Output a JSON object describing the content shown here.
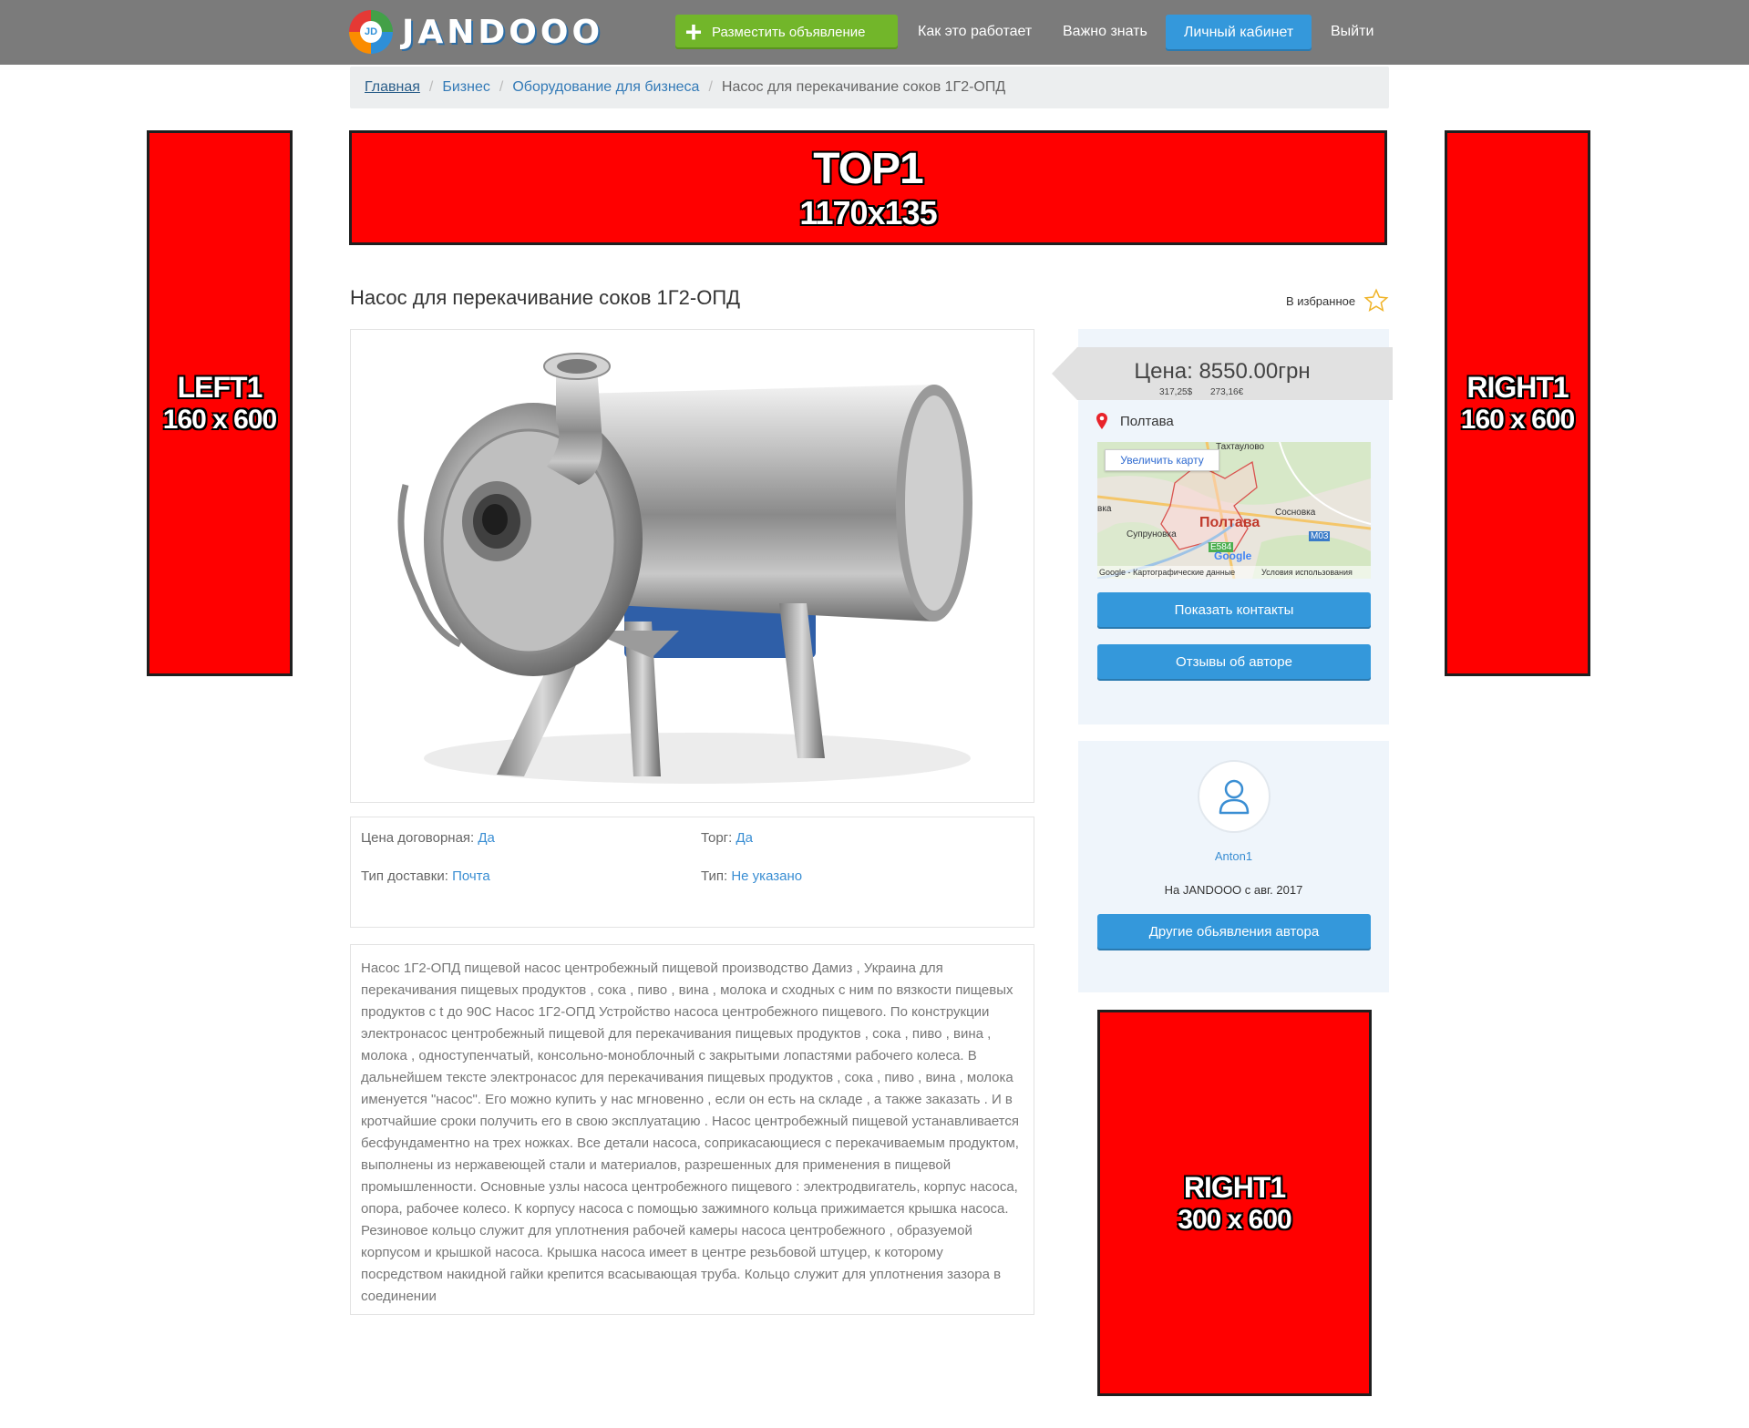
{
  "header": {
    "logo_text": "JANDOOO",
    "logo_mark": "JD",
    "post_ad_label": "Разместить объявление",
    "how_it_works": "Как это работает",
    "important": "Важно знать",
    "cabinet": "Личный кабинет",
    "logout": "Выйти"
  },
  "breadcrumb": {
    "items": [
      "Главная",
      "Бизнес",
      "Оборудование для бизнеса"
    ],
    "separator": "/",
    "current": "Насос для перекачивание соков 1Г2-ОПД"
  },
  "ads": {
    "top": {
      "name": "TOP1",
      "size": "1170x135"
    },
    "left": {
      "name": "LEFT1",
      "size": "160 x 600"
    },
    "right": {
      "name": "RIGHT1",
      "size": "160 x 600"
    },
    "right_big": {
      "name": "RIGHT1",
      "size": "300 x 600"
    }
  },
  "listing": {
    "title": "Насос для перекачивание соков 1Г2-ОПД",
    "favorite_label": "В избранное",
    "attributes": [
      {
        "label": "Цена договорная: ",
        "value": "Да"
      },
      {
        "label": "Торг: ",
        "value": "Да"
      },
      {
        "label": "Тип доставки: ",
        "value": "Почта"
      },
      {
        "label": "Тип: ",
        "value": "Не указано"
      }
    ],
    "description": "Насос 1Г2-ОПД пищевой насос центробежный пищевой производство Дамиз , Украина для перекачивания пищевых продуктов , сока , пиво , вина , молока и сходных с ним по вязкости пищевых продуктов с t до 90С Насос 1Г2-ОПД Устройство насоса центробежного пищевого. По конструкции электронасос центробежный пищевой для перекачивания пищевых продуктов , сока , пиво , вина , молока , одноступенчатый, консольно-моноблочный с закрытыми лопастями рабочего колеса. В дальнейшем тексте электронасос для перекачивания пищевых продуктов , сока , пиво , вина , молока именуется \"насос\". Его можно купить у нас мгновенно , если он есть на складе , а также заказать . И в кротчайшие сроки получить его в свою эксплуатацию . Насос центробежный пищевой устанавливается бесфундаментно на трех ножках. Все детали насоса, соприкасающиеся с перекачиваемым продуктом, выполнены из нержавеющей стали и материалов, разрешенных для применения в пищевой промышленности. Основные узлы насоса центробежного пищевого : электродвигатель, корпус насоса, опора, рабочее колесо. К корпусу насоса с помощью зажимного кольца прижимается крышка насоса. Резиновое кольцо служит для уплотнения рабочей камеры насоса центробежного , образуемой корпусом и крышкой насоса. Крышка насоса имеет в центре резьбовой штуцер, к которому посредством накидной гайки крепится всасывающая труба. Кольцо служит для уплотнения зазора в соединении"
  },
  "price": {
    "main": "Цена: 8550.00грн",
    "usd": "317,25$",
    "eur": "273,16€"
  },
  "location": {
    "city": "Полтава",
    "map_button": "Увеличить карту",
    "map_city": "Полтава",
    "map_labels": [
      "Тахтаулово",
      "Сосновка",
      "Супруновка",
      "вка",
      "M03",
      "E584"
    ],
    "map_footer_left": "Google - Картографические данные",
    "map_footer_right": "Условия использования",
    "google": "Google"
  },
  "actions": {
    "show_contacts": "Показать контакты",
    "author_reviews": "Отзывы об авторе",
    "other_ads": "Другие обьявления автора"
  },
  "author": {
    "name": "Anton1",
    "since": "На JANDOOO с авг. 2017"
  },
  "colors": {
    "header_bg": "#7b7b7b",
    "accent_blue": "#3498db",
    "accent_green": "#72b62a",
    "ad_red": "#ff0000"
  }
}
